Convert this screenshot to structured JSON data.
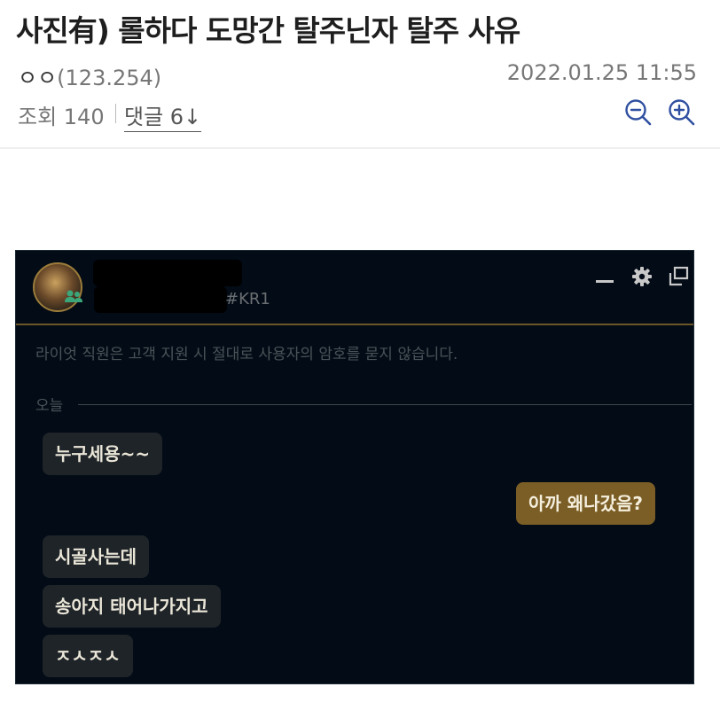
{
  "post": {
    "title": "사진有) 롤하다 도망간 탈주닌자 탈주 사유",
    "author_name": "ㅇㅇ",
    "author_ip": "(123.254)",
    "datetime": "2022.01.25 11:55",
    "views_label": "조회 140",
    "comments_label": "댓글 6↓"
  },
  "icons": {
    "zoom_out": "zoom-out-icon",
    "zoom_in": "zoom-in-icon",
    "minimize": "minimize-icon",
    "settings": "gear-icon",
    "popout": "popout-icon"
  },
  "client": {
    "riot_tag": "#KR1",
    "notice": "라이엇 직원은 고객 지원 시 절대로 사용자의 암호를 묻지 않습니다.",
    "day_label": "오늘",
    "messages": [
      {
        "text": "누구세용~~",
        "side": "incoming"
      },
      {
        "text": "아까 왜나갔음?",
        "side": "outgoing"
      },
      {
        "text": "시골사는데",
        "side": "incoming"
      },
      {
        "text": "송아지 태어나가지고",
        "side": "incoming"
      },
      {
        "text": "ㅈㅅㅈㅅ",
        "side": "incoming"
      }
    ]
  },
  "colors": {
    "accent_icon": "#2f4fa0",
    "client_bg": "#030b16",
    "gold": "#6b5628",
    "incoming_bubble": "#1f2428",
    "outgoing_bubble": "#7b5e26"
  }
}
